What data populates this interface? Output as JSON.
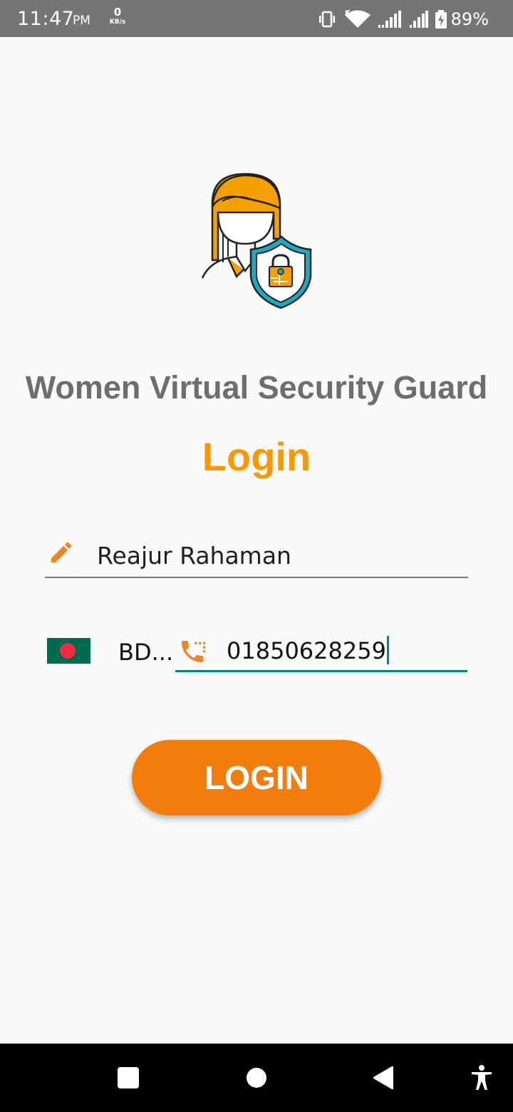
{
  "status_bar": {
    "time": "11:47",
    "ampm": "PM",
    "net_speed_value": "0",
    "net_speed_unit": "KB/s",
    "battery_percent": "89%",
    "icons": [
      "vibrate-icon",
      "wifi-icon",
      "signal-icon",
      "signal-icon",
      "battery-charging-icon"
    ]
  },
  "app": {
    "title": "Women Virtual Security Guard",
    "heading": "Login"
  },
  "form": {
    "name_value": "Reajur Rahaman",
    "country_code": "BD...",
    "phone_value": "01850628259",
    "login_button_label": "LOGIN"
  },
  "colors": {
    "accent_orange": "#ff9800",
    "button_orange": "#f27c0c",
    "title_gray": "#6e6e6e",
    "focus_teal": "#00897b",
    "shield_teal": "#1ba9c4"
  },
  "nav_bar": {
    "icons": [
      "recents-icon",
      "home-icon",
      "back-icon",
      "accessibility-icon"
    ]
  }
}
